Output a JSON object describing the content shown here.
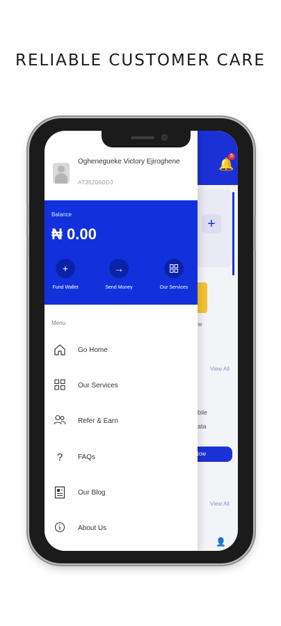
{
  "headline": "RELIABLE CUSTOMER CARE",
  "background_app": {
    "notification_count": "5",
    "text_fragment_1": "ow",
    "view_all_1": "View All",
    "text_fragment_2": "bile",
    "text_fragment_3": "ata",
    "button_fragment": "Now",
    "view_all_2": "View All"
  },
  "drawer": {
    "profile": {
      "name": "Oghenegueke Victory Ejiroghene",
      "id": "AT35206DD3"
    },
    "balance": {
      "label": "Balance",
      "amount": "₦ 0.00",
      "actions": [
        {
          "label": "Fund Wallet",
          "icon": "plus-icon"
        },
        {
          "label": "Send Money",
          "icon": "arrow-right-icon"
        },
        {
          "label": "Our Services",
          "icon": "grid-icon"
        }
      ]
    },
    "menu_label": "Menu",
    "menu": [
      {
        "label": "Go Home",
        "icon": "home-icon"
      },
      {
        "label": "Our Services",
        "icon": "grid-icon"
      },
      {
        "label": "Refer & Earn",
        "icon": "users-icon"
      },
      {
        "label": "FAQs",
        "icon": "question-icon"
      },
      {
        "label": "Our Blog",
        "icon": "blog-icon"
      },
      {
        "label": "About Us",
        "icon": "info-icon"
      }
    ]
  },
  "colors": {
    "brand_blue": "#1231dc",
    "dark_blue": "#0b22a8",
    "accent_yellow": "#f1c232",
    "badge_red": "#e53935"
  }
}
